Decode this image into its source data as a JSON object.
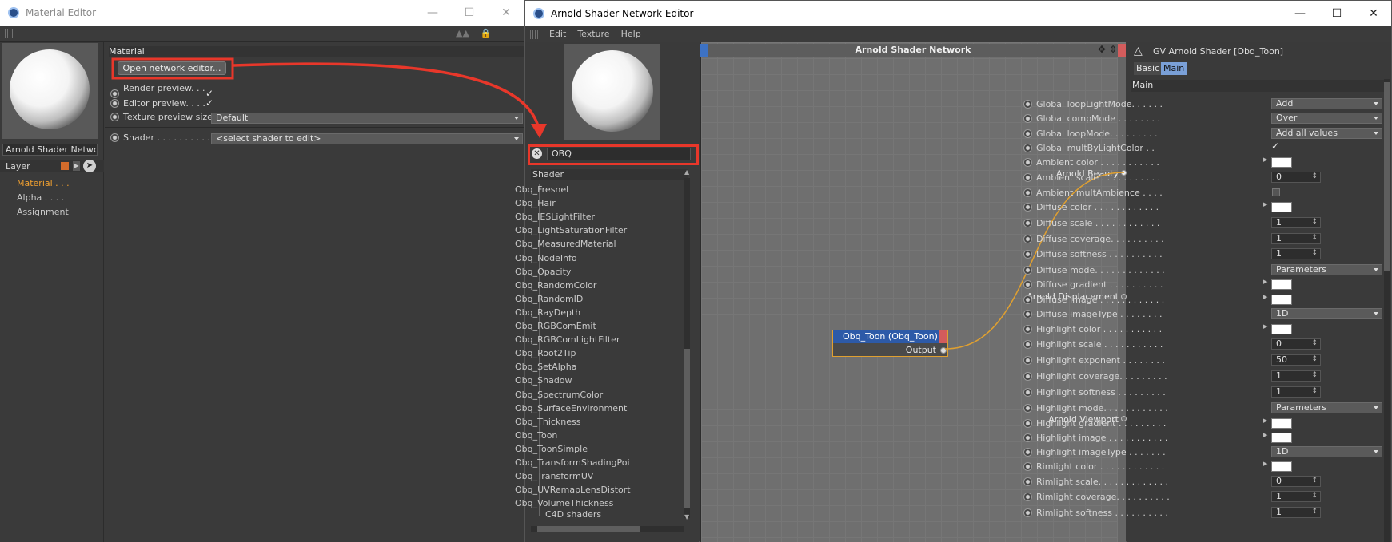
{
  "material_editor": {
    "title": "Material Editor",
    "material_name": "Arnold Shader Netwc",
    "layer_label": "Layer",
    "channels": [
      "Material . . .",
      "Alpha . . . .",
      "Assignment"
    ],
    "section_header": "Material",
    "open_network_button": "Open network editor...",
    "render_preview_label": "Render preview. . . .",
    "editor_preview_label": "Editor preview. . . .",
    "texture_preview_label": "Texture preview size",
    "texture_preview_value": "Default",
    "shader_label": "Shader . . . . . . . . . . .",
    "shader_value": "<select shader to edit>",
    "check": "✓"
  },
  "network_editor": {
    "title": "Arnold Shader Network Editor",
    "menu": [
      "Edit",
      "Texture",
      "Help"
    ],
    "search_value": "OBQ",
    "shader_header": "Shader",
    "shader_items": [
      "Obq_Fresnel",
      "Obq_Hair",
      "Obq_IESLightFilter",
      "Obq_LightSaturationFilter",
      "Obq_MeasuredMaterial",
      "Obq_NodeInfo",
      "Obq_Opacity",
      "Obq_RandomColor",
      "Obq_RandomID",
      "Obq_RayDepth",
      "Obq_RGBComEmit",
      "Obq_RGBComLightFilter",
      "Obq_Root2Tip",
      "Obq_SetAlpha",
      "Obq_Shadow",
      "Obq_SpectrumColor",
      "Obq_SurfaceEnvironment",
      "Obq_Thickness",
      "Obq_Toon",
      "Obq_ToonSimple",
      "Obq_TransformShadingPoi",
      "Obq_TransformUV",
      "Obq_UVRemapLensDistort",
      "Obq_VolumeThickness"
    ],
    "shader_group": "C4D shaders",
    "canvas_title": "Arnold Shader Network",
    "outputs": [
      "Arnold Beauty",
      "Arnold Displacement",
      "Arnold Viewport"
    ],
    "node_title": "Obq_Toon (Obq_Toon)",
    "node_output": "Output"
  },
  "attributes": {
    "title": "GV Arnold Shader [Obq_Toon]",
    "tabs": [
      "Basic",
      "Main"
    ],
    "section": "Main",
    "rows": [
      {
        "label": "Global loopLightMode. . . . . .",
        "kind": "drop",
        "value": "Add"
      },
      {
        "label": "Global compMode . . . . . . . .",
        "kind": "drop",
        "value": "Over"
      },
      {
        "label": "Global loopMode. . . . . . . . .",
        "kind": "drop",
        "value": "Add all values"
      },
      {
        "label": "Global multByLightColor . .",
        "kind": "check",
        "value": "✓"
      },
      {
        "label": "Ambient color . . . . . . . . . . .",
        "kind": "swatch",
        "value": ""
      },
      {
        "label": "Ambient scale . . . . . . . . . . .",
        "kind": "num",
        "value": "0"
      },
      {
        "label": "Ambient multAmbience . . . .",
        "kind": "box",
        "value": ""
      },
      {
        "label": "Diffuse color . . . . . . . . . . . .",
        "kind": "swatch",
        "value": ""
      },
      {
        "label": "Diffuse scale . . . . . . . . . . . .",
        "kind": "num",
        "value": "1"
      },
      {
        "label": "Diffuse coverage. . . . . . . . . .",
        "kind": "num",
        "value": "1"
      },
      {
        "label": "Diffuse softness . . . . . . . . . .",
        "kind": "num",
        "value": "1"
      },
      {
        "label": "Diffuse mode. . . . . . . . . . . . .",
        "kind": "drop",
        "value": "Parameters"
      },
      {
        "label": "Diffuse gradient . . . . . . . . . .",
        "kind": "swatch",
        "value": ""
      },
      {
        "label": "Diffuse image . . . . . . . . . . . .",
        "kind": "swatch",
        "value": ""
      },
      {
        "label": "Diffuse imageType . . . . . . . .",
        "kind": "drop",
        "value": "1D"
      },
      {
        "label": "Highlight color . . . . . . . . . . .",
        "kind": "swatch",
        "value": ""
      },
      {
        "label": "Highlight scale . . . . . . . . . . .",
        "kind": "num",
        "value": "0"
      },
      {
        "label": "Highlight exponent . . . . . . . .",
        "kind": "num",
        "value": "50"
      },
      {
        "label": "Highlight coverage. . . . . . . . .",
        "kind": "num",
        "value": "1"
      },
      {
        "label": "Highlight softness . . . . . . . . .",
        "kind": "num",
        "value": "1"
      },
      {
        "label": "Highlight mode. . . . . . . . . . . .",
        "kind": "drop",
        "value": "Parameters"
      },
      {
        "label": "Highlight gradient . . . . . . . . .",
        "kind": "swatch",
        "value": ""
      },
      {
        "label": "Highlight image . . . . . . . . . . .",
        "kind": "swatch",
        "value": ""
      },
      {
        "label": "Highlight imageType . . . . . . .",
        "kind": "drop",
        "value": "1D"
      },
      {
        "label": "Rimlight color . . . . . . . . . . . .",
        "kind": "swatch",
        "value": ""
      },
      {
        "label": "Rimlight scale. . . . . . . . . . . . .",
        "kind": "num",
        "value": "0"
      },
      {
        "label": "Rimlight coverage. . . . . . . . . .",
        "kind": "num",
        "value": "1"
      },
      {
        "label": "Rimlight softness . . . . . . . . . .",
        "kind": "num",
        "value": "1"
      }
    ]
  },
  "colors": {
    "annotation_red": "#e8372a",
    "node_wire": "#e0a030",
    "active_channel": "#f0a030"
  }
}
